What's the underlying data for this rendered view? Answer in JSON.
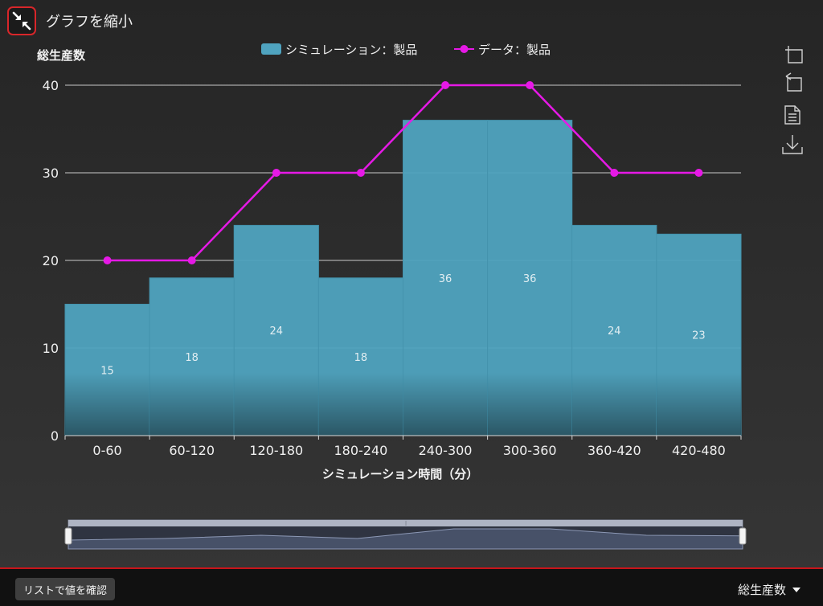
{
  "header": {
    "shrink_label": "グラフを縮小"
  },
  "footer": {
    "list_button": "リストで値を確認",
    "metric_selected": "総生産数"
  },
  "colors": {
    "bar": "#4fa3bf",
    "line": "#e619e6",
    "background": "#282828",
    "accent": "#c8141a"
  },
  "icons": [
    "shrink-icon",
    "zoom-icon",
    "zoom-reset-icon",
    "data-view-icon",
    "download-icon",
    "caret-down-icon"
  ],
  "chart_data": {
    "type": "bar",
    "ylabel": "総生産数",
    "xlabel": "シミュレーション時間（分）",
    "categories": [
      "0-60",
      "60-120",
      "120-180",
      "180-240",
      "240-300",
      "300-360",
      "360-420",
      "420-480"
    ],
    "ylim": [
      0,
      40
    ],
    "yticks": [
      0,
      10,
      20,
      30,
      40
    ],
    "grid": true,
    "legend_position": "top",
    "series": [
      {
        "name": "シミュレーション：製品",
        "type": "bar",
        "values": [
          15,
          18,
          24,
          18,
          36,
          36,
          24,
          23
        ],
        "color": "#4fa3bf",
        "data_labels": true
      },
      {
        "name": "データ：製品",
        "type": "line",
        "values": [
          20,
          20,
          30,
          30,
          40,
          40,
          30,
          30
        ],
        "color": "#e619e6"
      }
    ]
  }
}
